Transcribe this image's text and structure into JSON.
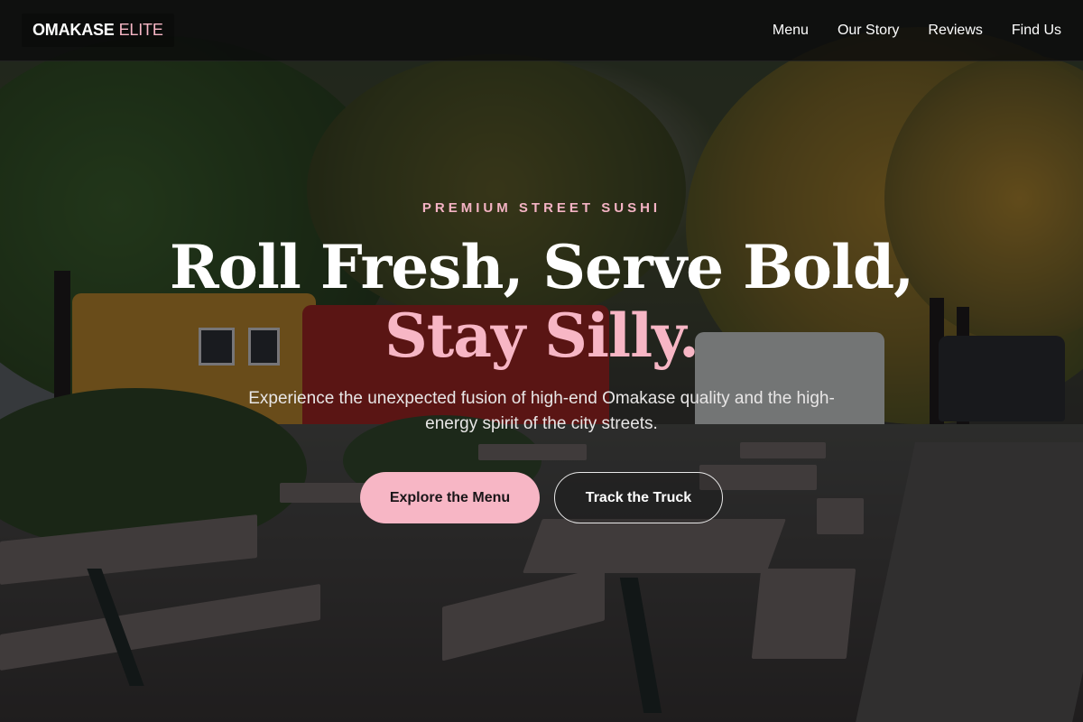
{
  "brand": {
    "name_main": "OMAKASE",
    "name_accent": "ELITE"
  },
  "nav": {
    "items": [
      {
        "label": "Menu"
      },
      {
        "label": "Our Story"
      },
      {
        "label": "Reviews"
      },
      {
        "label": "Find Us"
      }
    ]
  },
  "hero": {
    "eyebrow": "PREMIUM STREET SUSHI",
    "headline_line1": "Roll Fresh, Serve Bold,",
    "headline_line2": "Stay Silly.",
    "subtitle": "Experience the unexpected fusion of high-end Omakase quality and the high-energy spirit of the city streets.",
    "primary_cta": "Explore the Menu",
    "secondary_cta": "Track the Truck"
  },
  "colors": {
    "accent_pink": "#f7b6c5",
    "nav_background": "#0a0a0c",
    "text_primary": "#ffffff"
  }
}
